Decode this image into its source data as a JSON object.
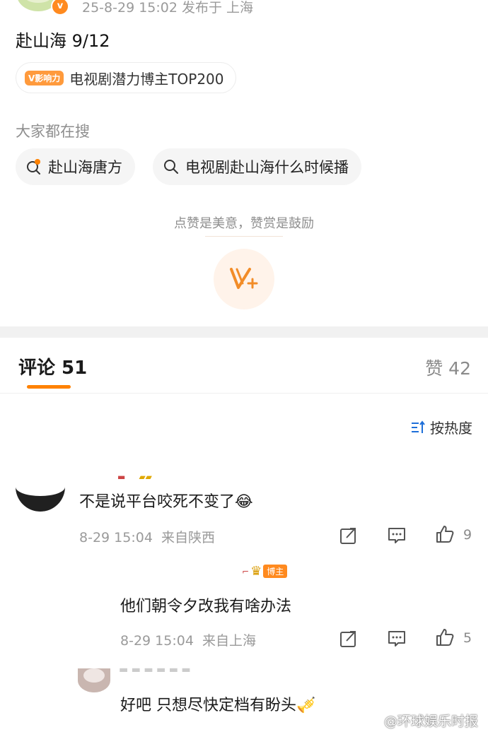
{
  "post": {
    "meta": "25-8-29 15:02  发布于 上海",
    "title": "赴山海 9/12",
    "influence_tag": "V影响力",
    "influence_text": "电视剧潜力博主TOP200"
  },
  "search": {
    "heading": "大家都在搜",
    "chips": [
      "赴山海唐方",
      "电视剧赴山海什么时候播"
    ]
  },
  "reward": {
    "text": "点赞是美意，赞赏是鼓励"
  },
  "tabs": {
    "comments": "评论 51",
    "likes": "赞 42"
  },
  "sort": {
    "label": "按热度"
  },
  "comments": [
    {
      "text": "不是说平台咬死不变了😂",
      "time": "8-29 15:04",
      "location": "来自陕西",
      "likes": "9"
    },
    {
      "text": "他们朝令夕改我有啥办法",
      "time": "8-29 15:04",
      "location": "来自上海",
      "likes": "5",
      "badge": "博主"
    },
    {
      "text": "好吧  只想尽快定档有盼头🎺"
    }
  ],
  "watermark": "@环球娱乐时报",
  "colors": {
    "accent": "#ff8200",
    "badge": "#ff8a1f"
  }
}
